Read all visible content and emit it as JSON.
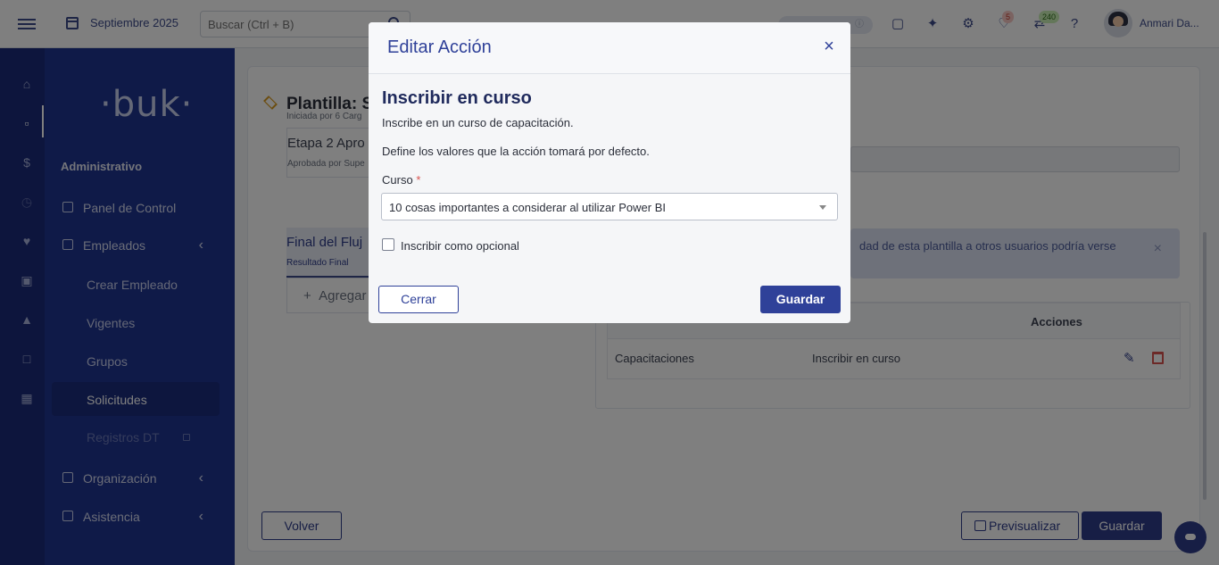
{
  "topbar": {
    "month": "Septiembre 2025",
    "search_placeholder": "Buscar (Ctrl + B)",
    "pill_text": "ⓘ",
    "notifications_count": "5",
    "messages_count": "240",
    "user_name": "Anmari Da..."
  },
  "sidebar": {
    "logo": "·buk·",
    "section": "Administrativo",
    "items": [
      {
        "label": "Panel de Control"
      },
      {
        "label": "Empleados"
      },
      {
        "label": "Organización"
      },
      {
        "label": "Asistencia"
      }
    ],
    "subitems": [
      {
        "label": "Crear Empleado"
      },
      {
        "label": "Vigentes"
      },
      {
        "label": "Grupos"
      },
      {
        "label": "Solicitudes"
      },
      {
        "label": "Registros DT"
      }
    ]
  },
  "main": {
    "title": "Plantilla: S",
    "stages": [
      {
        "subtitle": "Iniciada por 6 Carg"
      },
      {
        "title": "Etapa 2 Apro",
        "subtitle": "Aprobada por Supe"
      },
      {
        "title": "Final del Fluj",
        "subtitle": "Resultado Final"
      }
    ],
    "add_stage": "Agregar",
    "info_text": "dad de esta plantilla a otros usuarios podría verse",
    "table": {
      "header_actions": "Acciones",
      "rows": [
        {
          "category": "Capacitaciones",
          "action": "Inscribir en curso"
        }
      ]
    },
    "btn_volver": "Volver",
    "btn_preview": "Previsualizar",
    "btn_guardar": "Guardar"
  },
  "modal": {
    "title": "Editar Acción",
    "heading": "Inscribir en curso",
    "description": "Inscribe en un curso de capacitación.",
    "defaults_text": "Define los valores que la acción tomará por defecto.",
    "course_label": "Curso",
    "required_mark": "*",
    "course_value": "10 cosas importantes a considerar al utilizar Power BI",
    "optional_label": "Inscribir como opcional",
    "btn_close": "Cerrar",
    "btn_save": "Guardar"
  },
  "colors": {
    "primary": "#2f4199",
    "sidebar": "#1f3490",
    "rail": "#1b2b7a",
    "danger": "#d9534f"
  }
}
